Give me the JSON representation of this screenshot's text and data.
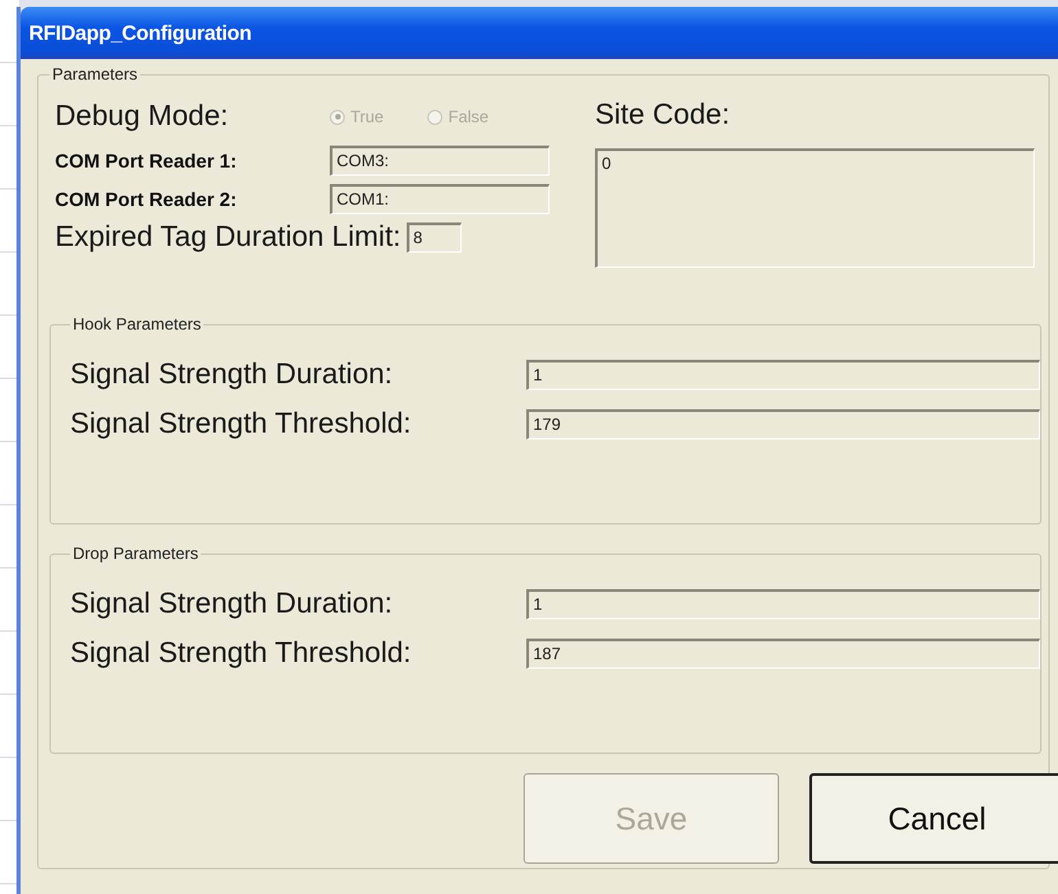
{
  "window": {
    "title": "RFIDapp_Configuration"
  },
  "parameters": {
    "legend": "Parameters",
    "debug_mode": {
      "label": "Debug Mode:",
      "disabled": true,
      "options": [
        {
          "label": "True",
          "selected": true
        },
        {
          "label": "False",
          "selected": false
        }
      ]
    },
    "site_code": {
      "label": "Site Code:",
      "value": "0"
    },
    "fields": [
      {
        "label": "COM Port Reader 1:",
        "value": "COM3:",
        "kind": "small"
      },
      {
        "label": "COM Port Reader 2:",
        "value": "COM1:",
        "kind": "small"
      },
      {
        "label": "Expired Tag Duration Limit:",
        "value": "8",
        "kind": "large"
      }
    ]
  },
  "groups": [
    {
      "legend": "Hook Parameters",
      "fields": [
        {
          "label": "Signal Strength Duration:",
          "value": "1"
        },
        {
          "label": "Signal Strength Threshold:",
          "value": "179"
        }
      ]
    },
    {
      "legend": "Drop Parameters",
      "fields": [
        {
          "label": "Signal Strength Duration:",
          "value": "1"
        },
        {
          "label": "Signal Strength Threshold:",
          "value": "187"
        }
      ]
    }
  ],
  "buttons": [
    {
      "label": "Save",
      "disabled": true
    },
    {
      "label": "Cancel",
      "disabled": false
    }
  ]
}
